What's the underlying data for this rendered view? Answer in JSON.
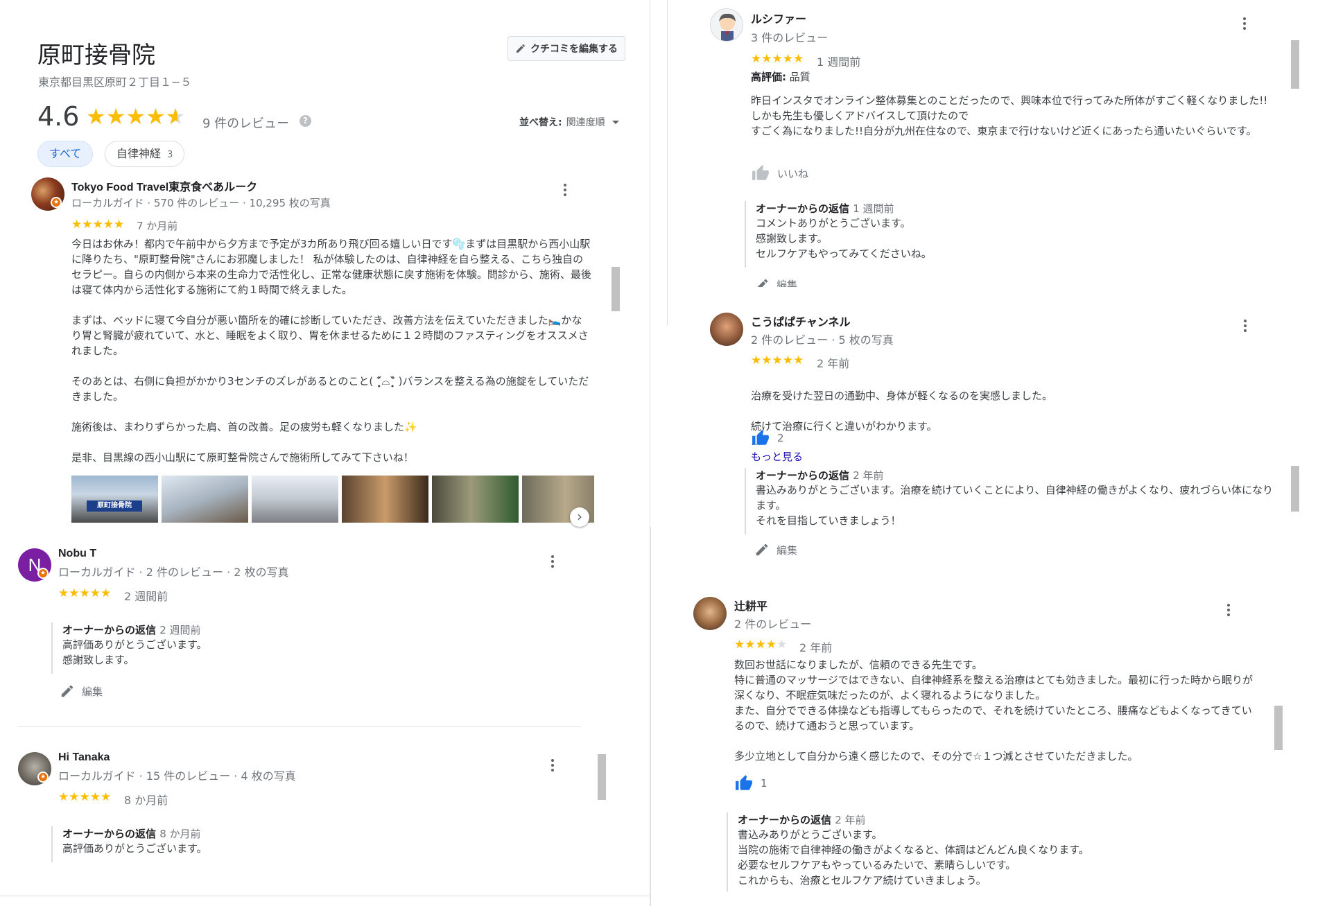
{
  "place": {
    "title": "原町接骨院",
    "address": "東京都目黒区原町２丁目１−５",
    "rating": "4.6",
    "review_count": "9 件のレビュー",
    "edit_review_button": "クチコミを編集する",
    "sort_label": "並べ替え:",
    "sort_value": "関連度順",
    "chips": [
      {
        "label": "すべて",
        "count": ""
      },
      {
        "label": "自律神経",
        "count": "3"
      }
    ]
  },
  "reviews": [
    {
      "author": "Tokyo Food Travel東京食べあルーク",
      "meta": "ローカルガイド · 570 件のレビュー · 10,295 枚の写真",
      "rating": 5,
      "time": "7 か月前",
      "text": "今日はお休み！都内で午前中から夕方まで予定が3カ所あり飛び回る嬉しい日です🫧まずは目黒駅から西小山駅に降りたち、\"原町整骨院\"さんにお邪魔しました！ 私が体験したのは、自律神経を自ら整える、こちら独自のセラピー。自らの内側から本来の生命力で活性化し、正常な健康状態に戻す施術を体験。問診から、施術、最後は寝て体内から活性化する施術にて約１時間で終えました。\n\nまずは、ベッドに寝て今自分が悪い箇所を的確に診断していただき、改善方法を伝えていただきました🛌かなり胃と腎臓が疲れていて、水と、睡眠をよく取り、胃を休ませるために１２時間のファスティングをオススメされました。\n\nそのあとは、右側に負担がかかり3センチのズレがあるとのこと( ˃̣̣̥᷄⌓˂̣̣̥᷅ )バランスを整える為の施錠をしていただきました。\n\n施術後は、まわりずらかった肩、首の改善。足の疲労も軽くなりました✨\n\n是非、目黒線の西小山駅にて原町整骨院さんで施術所してみて下さいね！"
    },
    {
      "author": "Nobu T",
      "avatar_letter": "N",
      "meta": "ローカルガイド · 2 件のレビュー · 2 枚の写真",
      "rating": 5,
      "time": "2 週間前",
      "reply_title": "オーナーからの返信",
      "reply_time": "2 週間前",
      "reply_text": "高評価ありがとうございます。\n感謝致します。",
      "edit_label": "編集"
    },
    {
      "author": "Hi Tanaka",
      "meta": "ローカルガイド · 15 件のレビュー · 4 枚の写真",
      "rating": 5,
      "time": "8 か月前",
      "reply_title": "オーナーからの返信",
      "reply_time": "8 か月前",
      "reply_text": "高評価ありがとうございます。"
    },
    {
      "author": "ルシファー",
      "meta": "3 件のレビュー",
      "rating": 5,
      "time": "1 週間前",
      "highlight_label": "高評価:",
      "highlight_value": "品質",
      "text": "昨日インスタでオンライン整体募集とのことだったので、興味本位で行ってみた所体がすごく軽くなりました!!しかも先生も優しくアドバイスして頂けたので\nすごく為になりました!!自分が九州在住なので、東京まで行けないけど近くにあったら通いたいぐらいです。",
      "like_label": "いいね",
      "reply_title": "オーナーからの返信",
      "reply_time": "1 週間前",
      "reply_text": "コメントありがとうございます。\n感謝致します。\nセルフケアもやってみてくださいね。",
      "edit_label": "編集"
    },
    {
      "author": "こうぱぱチャンネル",
      "meta": "2 件のレビュー · 5 枚の写真",
      "rating": 5,
      "time": "2 年前",
      "text": "治療を受けた翌日の通勤中、身体が軽くなるのを実感しました。\n\n続けて治療に行くと違いがわかります。",
      "more_ellipsis": "…",
      "more_label": "もっと見る",
      "likes": "2",
      "reply_title": "オーナーからの返信",
      "reply_time": "2 年前",
      "reply_text": "書込みありがとうございます。治療を続けていくことにより、自律神経の働きがよくなり、疲れづらい体になります。\nそれを目指していきましょう！",
      "edit_label": "編集"
    },
    {
      "author": "辻耕平",
      "meta": "2 件のレビュー",
      "rating": 4,
      "time": "2 年前",
      "text": "数回お世話になりましたが、信頼のできる先生です。\n特に普通のマッサージではできない、自律神経系を整える治療はとても効きました。最初に行った時から眠りが深くなり、不眠症気味だったのが、よく寝れるようになりました。\nまた、自分でできる体操なども指導してもらったので、それを続けていたところ、腰痛などもよくなってきているので、続けて通おうと思っています。\n\n多少立地として自分から遠く感じたので、その分で☆１つ減とさせていただきました。",
      "likes": "1",
      "reply_title": "オーナーからの返信",
      "reply_time": "2 年前",
      "reply_text": "書込みありがとうございます。\n当院の施術で自律神経の働きがよくなると、体調はどんどん良くなります。\n必要なセルフケアもやっているみたいで、素晴らしいです。\nこれからも、治療とセルフケア続けていきましょう。"
    }
  ],
  "photo_sign_text": "原町接骨院",
  "colors": {
    "star": "#fbbc04",
    "accent": "#1a73e8",
    "chip_active_bg": "#e8f0fe",
    "badge": "#e8710a"
  }
}
